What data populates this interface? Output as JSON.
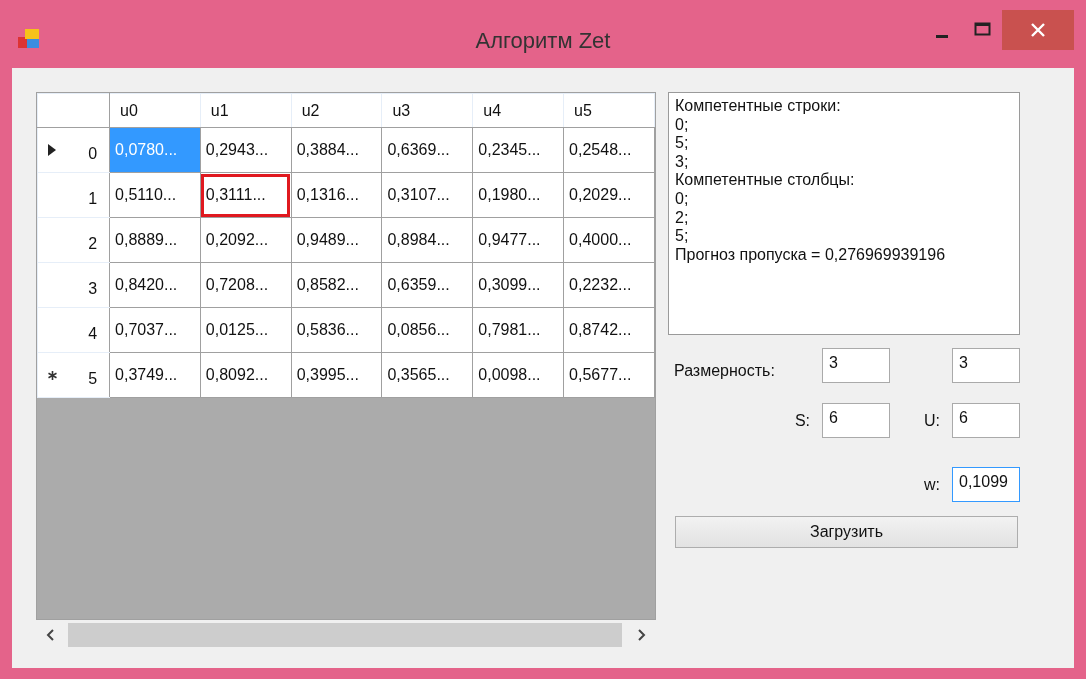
{
  "window": {
    "title": "Алгоритм Zet"
  },
  "grid": {
    "columns": [
      "u0",
      "u1",
      "u2",
      "u3",
      "u4",
      "u5"
    ],
    "rows": [
      {
        "header": "0",
        "current": true,
        "new_row": false,
        "cells": [
          {
            "text": "0,0780...",
            "selected": true,
            "highlighted": false
          },
          {
            "text": "0,2943...",
            "selected": false,
            "highlighted": false
          },
          {
            "text": "0,3884...",
            "selected": false,
            "highlighted": false
          },
          {
            "text": "0,6369...",
            "selected": false,
            "highlighted": false
          },
          {
            "text": "0,2345...",
            "selected": false,
            "highlighted": false
          },
          {
            "text": "0,2548...",
            "selected": false,
            "highlighted": false
          }
        ]
      },
      {
        "header": "1",
        "current": false,
        "new_row": false,
        "cells": [
          {
            "text": "0,5110...",
            "selected": false,
            "highlighted": false
          },
          {
            "text": "0,3111...",
            "selected": false,
            "highlighted": true
          },
          {
            "text": "0,1316...",
            "selected": false,
            "highlighted": false
          },
          {
            "text": "0,3107...",
            "selected": false,
            "highlighted": false
          },
          {
            "text": "0,1980...",
            "selected": false,
            "highlighted": false
          },
          {
            "text": "0,2029...",
            "selected": false,
            "highlighted": false
          }
        ]
      },
      {
        "header": "2",
        "current": false,
        "new_row": false,
        "cells": [
          {
            "text": "0,8889...",
            "selected": false,
            "highlighted": false
          },
          {
            "text": "0,2092...",
            "selected": false,
            "highlighted": false
          },
          {
            "text": "0,9489...",
            "selected": false,
            "highlighted": false
          },
          {
            "text": "0,8984...",
            "selected": false,
            "highlighted": false
          },
          {
            "text": "0,9477...",
            "selected": false,
            "highlighted": false
          },
          {
            "text": "0,4000...",
            "selected": false,
            "highlighted": false
          }
        ]
      },
      {
        "header": "3",
        "current": false,
        "new_row": false,
        "cells": [
          {
            "text": "0,8420...",
            "selected": false,
            "highlighted": false
          },
          {
            "text": "0,7208...",
            "selected": false,
            "highlighted": false
          },
          {
            "text": "0,8582...",
            "selected": false,
            "highlighted": false
          },
          {
            "text": "0,6359...",
            "selected": false,
            "highlighted": false
          },
          {
            "text": "0,3099...",
            "selected": false,
            "highlighted": false
          },
          {
            "text": "0,2232...",
            "selected": false,
            "highlighted": false
          }
        ]
      },
      {
        "header": "4",
        "current": false,
        "new_row": false,
        "cells": [
          {
            "text": "0,7037...",
            "selected": false,
            "highlighted": false
          },
          {
            "text": "0,0125...",
            "selected": false,
            "highlighted": false
          },
          {
            "text": "0,5836...",
            "selected": false,
            "highlighted": false
          },
          {
            "text": "0,0856...",
            "selected": false,
            "highlighted": false
          },
          {
            "text": "0,7981...",
            "selected": false,
            "highlighted": false
          },
          {
            "text": "0,8742...",
            "selected": false,
            "highlighted": false
          }
        ]
      },
      {
        "header": "5",
        "current": false,
        "new_row": true,
        "cells": [
          {
            "text": "0,3749...",
            "selected": false,
            "highlighted": false
          },
          {
            "text": "0,8092...",
            "selected": false,
            "highlighted": false
          },
          {
            "text": "0,3995...",
            "selected": false,
            "highlighted": false
          },
          {
            "text": "0,3565...",
            "selected": false,
            "highlighted": false
          },
          {
            "text": "0,0098...",
            "selected": false,
            "highlighted": false
          },
          {
            "text": "0,5677...",
            "selected": false,
            "highlighted": false
          }
        ]
      }
    ]
  },
  "output": {
    "lines": [
      "Компетентные строки:",
      "0;",
      "5;",
      "3;",
      "Компетентные столбцы:",
      "0;",
      "2;",
      "5;",
      "Прогноз пропуска = 0,276969939196"
    ]
  },
  "form": {
    "dimension_label": "Размерность:",
    "dimension_1": "3",
    "dimension_2": "3",
    "s_label": "S:",
    "s_value": "6",
    "u_label": "U:",
    "u_value": "6",
    "w_label": "w:",
    "w_value": "0,1099",
    "w_focused": true,
    "load_button": "Загрузить"
  }
}
